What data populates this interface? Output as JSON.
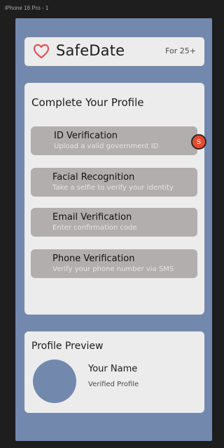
{
  "frame": {
    "label": "iPhone 16 Pro - 1"
  },
  "header": {
    "title": "SafeDate",
    "age_label": "For 25+",
    "heart_color": "#e0525a"
  },
  "profile": {
    "title": "Complete Your Profile",
    "steps": [
      {
        "label": "ID Verification",
        "subtitle": "Upload a valid government ID"
      },
      {
        "label": "Facial Recognition",
        "subtitle": "Take a selfie to verify your identity"
      },
      {
        "label": "Email Verification",
        "subtitle": "Enter confirmation code"
      },
      {
        "label": "Phone Verification",
        "subtitle": "Verify your phone number via SMS"
      }
    ]
  },
  "status_dot": {
    "letter": "S",
    "color": "#e84b2e"
  },
  "preview": {
    "title": "Profile Preview",
    "name": "Your Name",
    "status": "Verified Profile"
  },
  "colors": {
    "background": "#7289ad",
    "card": "#ececec",
    "step": "#b3aeae"
  }
}
